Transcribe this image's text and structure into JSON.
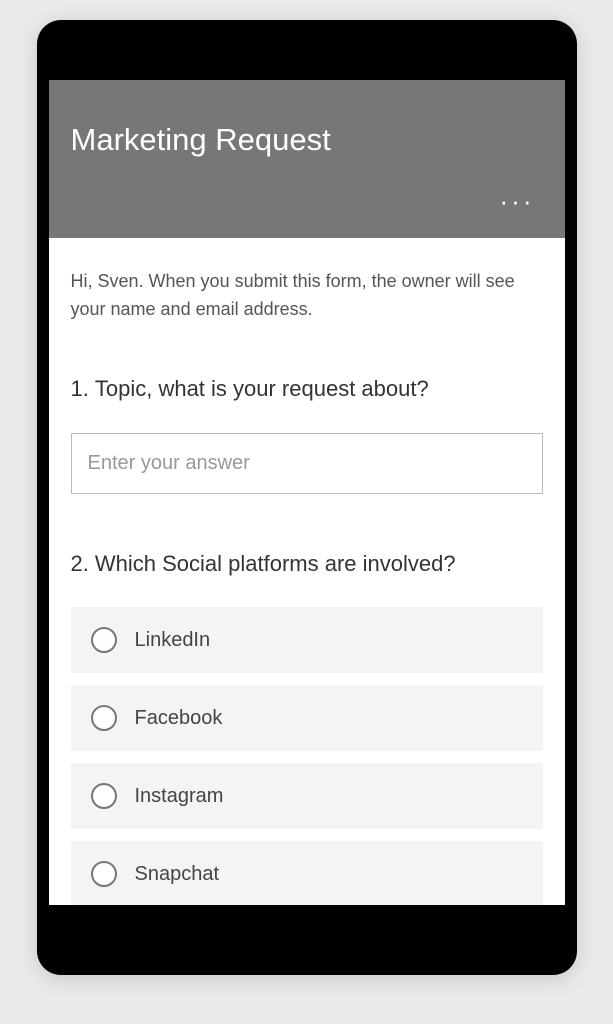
{
  "form": {
    "title": "Marketing Request",
    "moreLabel": "···",
    "intro": "Hi, Sven. When you submit this form, the owner will see your name and email address.",
    "questions": [
      {
        "number": "1.",
        "text": "Topic, what is your request about?",
        "placeholder": "Enter your answer"
      },
      {
        "number": "2.",
        "text": "Which Social platforms are involved?",
        "options": [
          "LinkedIn",
          "Facebook",
          "Instagram",
          "Snapchat"
        ]
      }
    ]
  }
}
